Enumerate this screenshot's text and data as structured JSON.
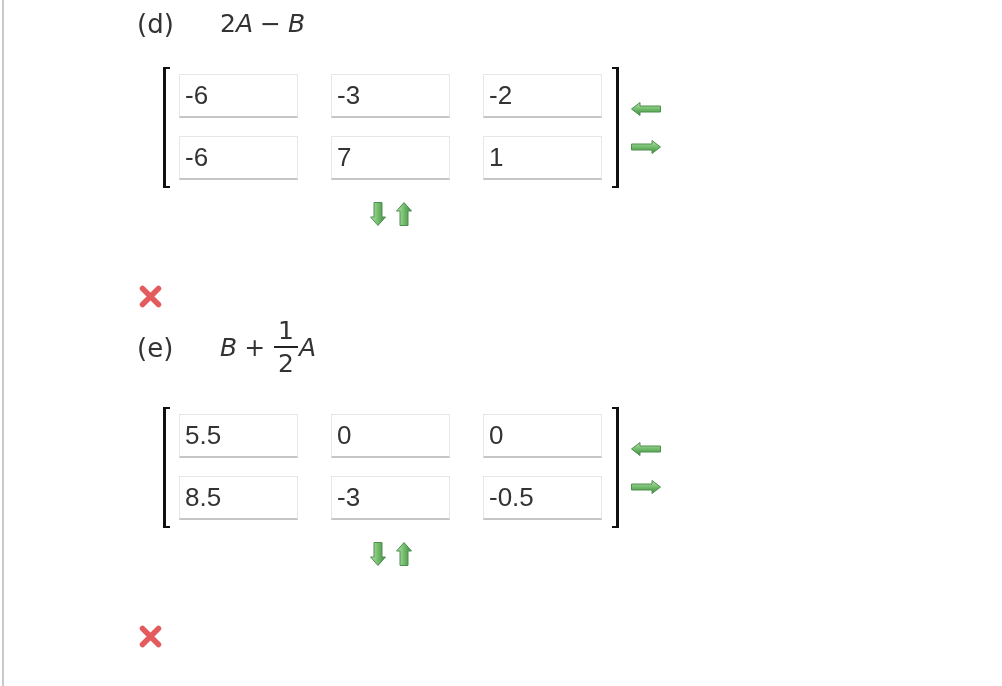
{
  "parts": [
    {
      "label": "(d)",
      "expression": [
        {
          "kind": "number",
          "text": "2"
        },
        {
          "kind": "variable",
          "text": "A"
        },
        {
          "kind": "operator",
          "text": "−"
        },
        {
          "kind": "variable",
          "text": "B"
        }
      ],
      "matrix": {
        "rows": [
          [
            "-6",
            "-3",
            "-2"
          ],
          [
            "-6",
            "7",
            "1"
          ]
        ]
      },
      "correct": false
    },
    {
      "label": "(e)",
      "expression": [
        {
          "kind": "variable",
          "text": "B"
        },
        {
          "kind": "operator",
          "text": "+"
        },
        {
          "kind": "fraction",
          "numerator": "1",
          "denominator": "2"
        },
        {
          "kind": "variable",
          "text": "A"
        }
      ],
      "matrix": {
        "rows": [
          [
            "5.5",
            "0",
            "0"
          ],
          [
            "8.5",
            "-3",
            "-0.5"
          ]
        ]
      },
      "correct": false
    }
  ]
}
